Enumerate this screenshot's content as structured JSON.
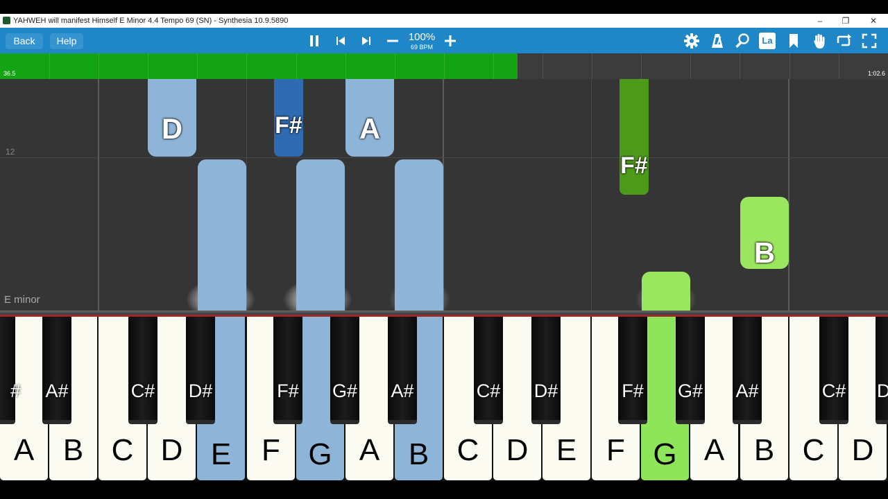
{
  "window": {
    "title": "YAHWEH will manifest Himself E Minor 4.4 Tempo 69 (SN) - Synthesia 10.9.5890",
    "minimize_glyph": "–",
    "restore_glyph": "❐",
    "close_glyph": "✕"
  },
  "toolbar": {
    "back_label": "Back",
    "help_label": "Help",
    "speed_percent": "100%",
    "tempo_bpm": "69 BPM",
    "label_button_text": "La",
    "icons": [
      "pause-icon",
      "previous-icon",
      "next-icon",
      "minus-icon",
      "plus-icon",
      "gear-icon",
      "metronome-icon",
      "magnifier-icon",
      "note-label-icon",
      "bookmark-icon",
      "hand-icon",
      "loop-icon",
      "fullscreen-icon"
    ]
  },
  "progress": {
    "current_time": "36.5",
    "total_time": "1:02.6",
    "fraction": 0.583,
    "fill_color": "#13a313"
  },
  "notearea": {
    "measure_number": "12",
    "key_signature": "E minor"
  },
  "falling_notes": [
    {
      "label": "D",
      "hand": "left-light"
    },
    {
      "label": "F#",
      "hand": "left-dark"
    },
    {
      "label": "A",
      "hand": "left-light"
    },
    {
      "label": "",
      "hand": "left-light"
    },
    {
      "label": "",
      "hand": "left-light"
    },
    {
      "label": "",
      "hand": "left-light"
    },
    {
      "label": "F#",
      "hand": "right-dark"
    },
    {
      "label": "B",
      "hand": "right-light"
    },
    {
      "label": "",
      "hand": "right-light"
    }
  ],
  "colors": {
    "left_hand_light": "#8eb4d7",
    "left_hand_dark": "#2f6bb0",
    "right_hand_light": "#9be65f",
    "right_hand_dark": "#4d9a1a",
    "toolbar": "#1f87c8"
  },
  "keyboard": {
    "white_keys": [
      {
        "label": "A",
        "state": "off"
      },
      {
        "label": "B",
        "state": "off"
      },
      {
        "label": "C",
        "state": "off"
      },
      {
        "label": "D",
        "state": "off"
      },
      {
        "label": "E",
        "state": "left"
      },
      {
        "label": "F",
        "state": "off"
      },
      {
        "label": "G",
        "state": "left"
      },
      {
        "label": "A",
        "state": "off"
      },
      {
        "label": "B",
        "state": "left"
      },
      {
        "label": "C",
        "state": "off"
      },
      {
        "label": "D",
        "state": "off"
      },
      {
        "label": "E",
        "state": "off"
      },
      {
        "label": "F",
        "state": "off"
      },
      {
        "label": "G",
        "state": "right"
      },
      {
        "label": "A",
        "state": "off"
      },
      {
        "label": "B",
        "state": "off"
      },
      {
        "label": "C",
        "state": "off"
      },
      {
        "label": "D",
        "state": "off"
      }
    ],
    "black_keys": [
      {
        "label": "#"
      },
      {
        "label": "A#"
      },
      {
        "label": "C#"
      },
      {
        "label": "D#"
      },
      {
        "label": "F#"
      },
      {
        "label": "G#"
      },
      {
        "label": "A#"
      },
      {
        "label": "C#"
      },
      {
        "label": "D#"
      },
      {
        "label": "F#"
      },
      {
        "label": "G#"
      },
      {
        "label": "A#"
      },
      {
        "label": "C#"
      },
      {
        "label": "D"
      }
    ]
  }
}
